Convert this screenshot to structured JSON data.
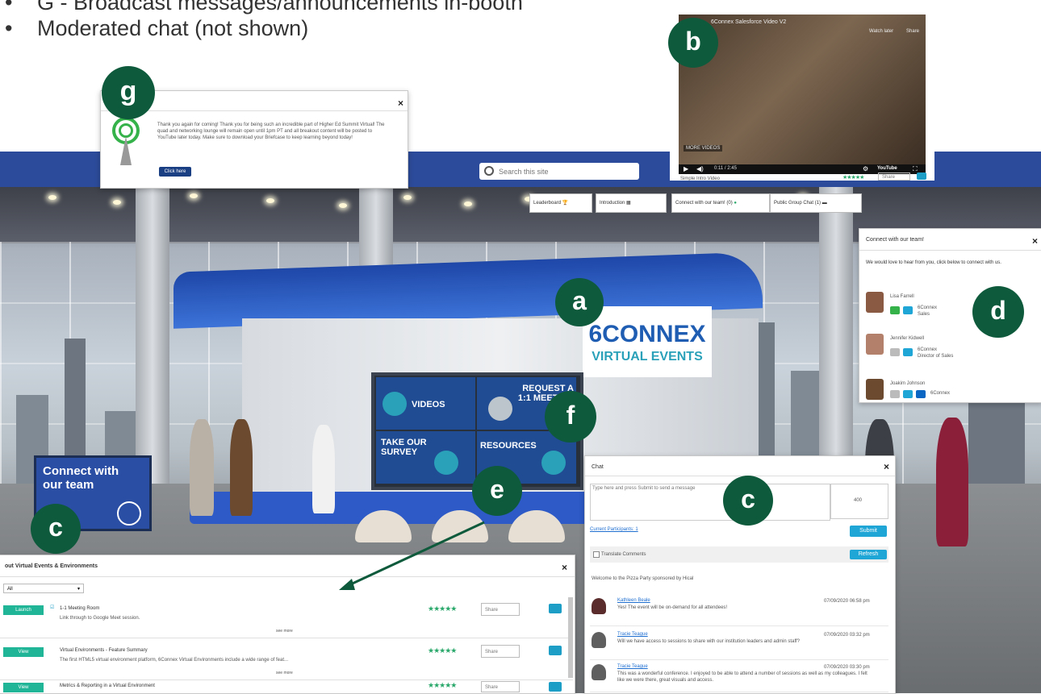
{
  "bullets": [
    "G - Broadcast messages/announcements in-booth",
    "Moderated chat (not shown)"
  ],
  "search": {
    "placeholder": "Search this site"
  },
  "nav_buttons": {
    "leaderboard": "Leaderboard",
    "introduction": "Introduction",
    "connect": "Connect with our team! (0)",
    "group_chat": "Public Group Chat (1)"
  },
  "badges": {
    "a": "a",
    "b": "b",
    "c": "c",
    "d": "d",
    "e": "e",
    "f": "f",
    "g": "g"
  },
  "announcement": {
    "message": "Thank you again for coming! Thank you for being such an incredible part of Higher Ed Summit Virtual! The quad and networking lounge will remain open until 1pm PT and all breakout content will be posted to YouTube later today. Make sure to download your Briefcase to keep learning beyond today!",
    "button": "Click here"
  },
  "video": {
    "title": "6Connex Salesforce Video V2",
    "label": "Simple Intro Video",
    "watch_later": "Watch later",
    "share": "Share",
    "more_videos": "MORE VIDEOS",
    "time": "0:11 / 2:45",
    "share_btn": "Share",
    "brand": "YouTube"
  },
  "booth": {
    "logo_main": "6CONNEX",
    "logo_sub": "VIRTUAL EVENTS",
    "tiles": [
      "VIDEOS",
      "REQUEST A 1:1 MEETING",
      "TAKE OUR SURVEY",
      "RESOURCES"
    ],
    "connect_board": "Connect with our team"
  },
  "team": {
    "title": "Connect with our team!",
    "intro": "We would love to hear from you, click below to connect with us.",
    "members": [
      {
        "name": "Lisa Farrell",
        "company": "6Connex",
        "role": "Sales"
      },
      {
        "name": "Jennifer Kidwell",
        "company": "6Connex",
        "role": "Director of Sales"
      },
      {
        "name": "Joakim Johnson",
        "company": "6Connex",
        "role": ""
      }
    ]
  },
  "chat": {
    "title": "Chat",
    "placeholder": "Type here and press Submit to send a message",
    "counter": "400",
    "participants": "Current Participants: 1",
    "submit": "Submit",
    "translate": "Translate Comments",
    "refresh": "Refresh",
    "welcome": "Welcome to the Pizza Party sponsored by Hical",
    "messages": [
      {
        "author": "Kathleen Beale",
        "time": "07/09/2020 06:58 pm",
        "text": "Yes! The event will be on-demand for all attendees!"
      },
      {
        "author": "Tracie Teague",
        "time": "07/09/2020 03:32 pm",
        "text": "Will we have access to sessions to share with our institution leaders and admin staff?"
      },
      {
        "author": "Tracie Teague",
        "time": "07/09/2020 03:30 pm",
        "text": "This was a wonderful conference. I enjoyed to be able to attend a number of sessions as well as my colleagues. I felt like we were there, great visuals and access."
      }
    ]
  },
  "resources": {
    "title": "out Virtual Events & Environments",
    "filter": "All",
    "items": [
      {
        "button": "Launch",
        "title": "1-1 Meeting Room",
        "desc": "Link through to Google Meet session."
      },
      {
        "button": "View",
        "title": "Virtual Environments - Feature Summary",
        "desc": "The first HTML5 virtual environment platform, 6Connex Virtual Environments include a wide range of feat..."
      },
      {
        "button": "View",
        "title": "Metrics & Reporting in a Virtual Environment",
        "desc": ""
      }
    ],
    "more_label": "see more",
    "share": "Share",
    "stars": "★★★★★"
  },
  "colors": {
    "badge": "#0e5a3c",
    "nav": "#2c4b9a",
    "teal": "#20a6d6",
    "accent_green": "#20b597"
  }
}
